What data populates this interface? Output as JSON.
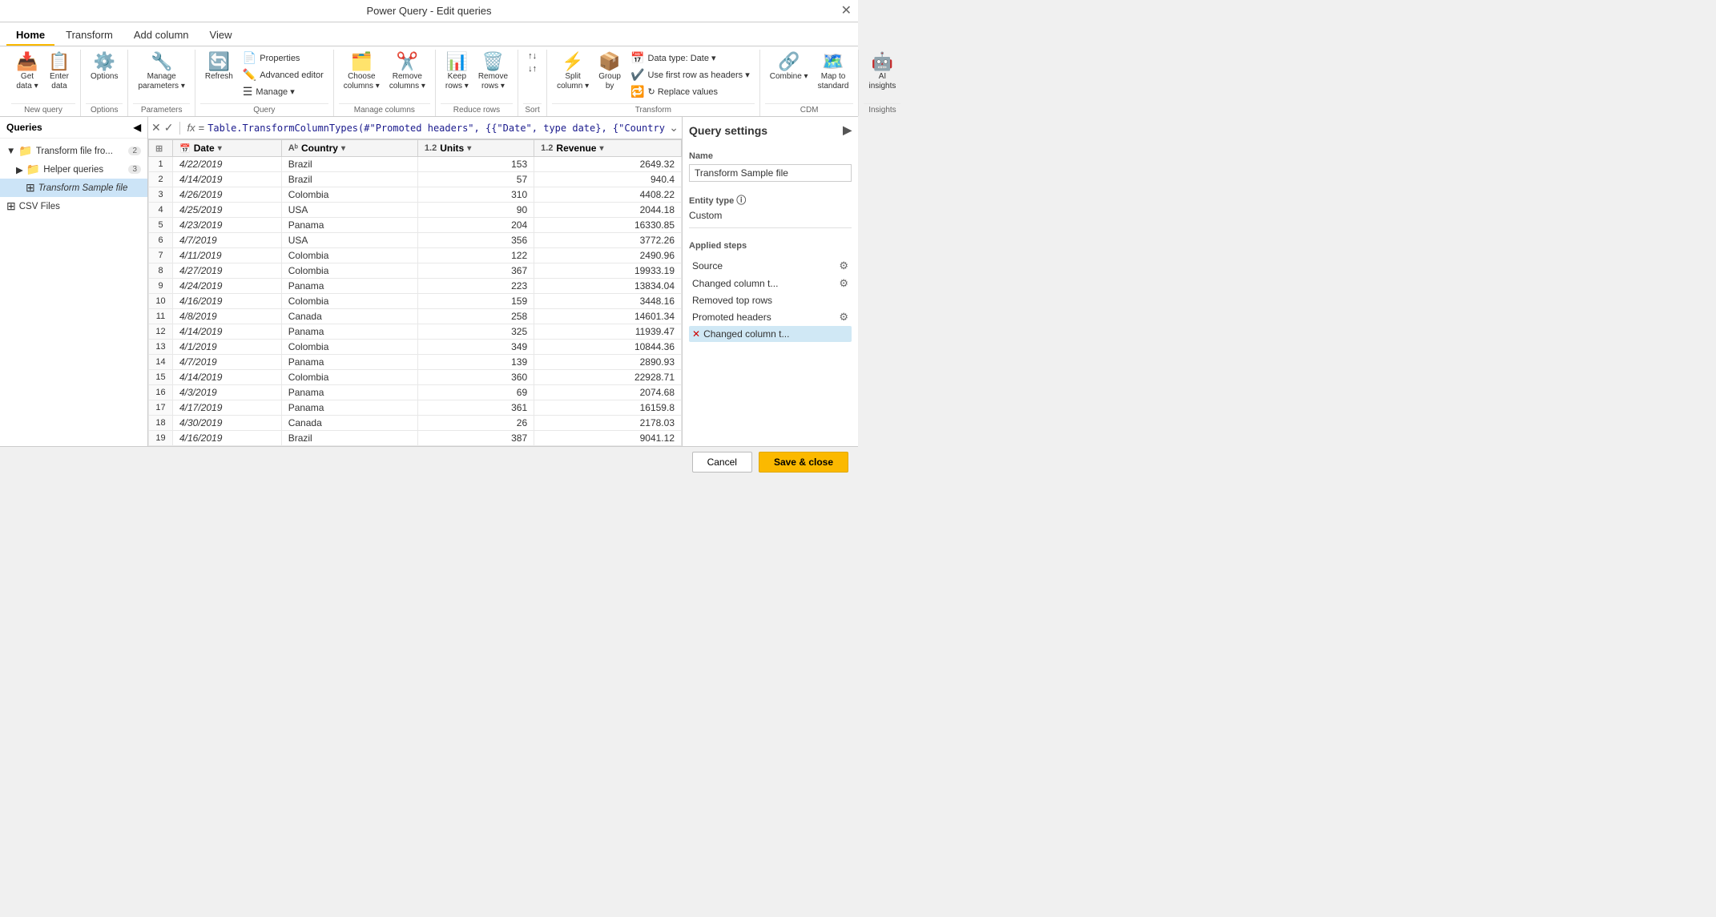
{
  "window": {
    "title": "Power Query - Edit queries",
    "close_btn": "✕"
  },
  "ribbon_tabs": [
    {
      "label": "Home",
      "active": true
    },
    {
      "label": "Transform",
      "active": false
    },
    {
      "label": "Add column",
      "active": false
    },
    {
      "label": "View",
      "active": false
    }
  ],
  "ribbon": {
    "new_query_group": {
      "label": "New query",
      "get_data": "Get data",
      "enter_data": "Enter data"
    },
    "options_group": {
      "label": "Options",
      "options": "Options"
    },
    "parameters_group": {
      "label": "Parameters",
      "manage_parameters": "Manage parameters"
    },
    "query_group": {
      "label": "Query",
      "properties": "Properties",
      "advanced_editor": "Advanced editor",
      "manage": "Manage",
      "refresh": "Refresh"
    },
    "manage_columns_group": {
      "label": "Manage columns",
      "choose_columns": "Choose columns",
      "remove_columns": "Remove columns"
    },
    "reduce_rows_group": {
      "label": "Reduce rows",
      "keep_rows": "Keep rows",
      "remove_rows": "Remove rows"
    },
    "sort_group": {
      "label": "Sort",
      "sort_asc": "↑",
      "sort_desc": "↓"
    },
    "transform_group": {
      "label": "Transform",
      "split_column": "Split column",
      "group_by": "Group by",
      "data_type": "Data type: Date",
      "use_first_row": "Use first row as headers",
      "replace_values": "Replace values"
    },
    "cdm_group": {
      "label": "CDM",
      "combine": "Combine",
      "map_to_standard": "Map to standard"
    },
    "insights_group": {
      "label": "Insights",
      "ai_insights": "AI insights"
    }
  },
  "formula_bar": {
    "formula": "Table.TransformColumnTypes(#\"Promoted headers\", {{\"Date\", type date}, {\"Country\", type text},"
  },
  "queries": {
    "header": "Queries",
    "items": [
      {
        "label": "Transform file fro...",
        "indent": 0,
        "icon": "📁",
        "badge": "2",
        "expanded": true
      },
      {
        "label": "Helper queries",
        "indent": 1,
        "icon": "📁",
        "badge": "3",
        "expanded": true
      },
      {
        "label": "Transform Sample file",
        "indent": 2,
        "icon": "⊞",
        "selected": true
      },
      {
        "label": "CSV Files",
        "indent": 0,
        "icon": "⊞",
        "selected": false
      }
    ]
  },
  "grid": {
    "columns": [
      {
        "label": "Date",
        "type": "📅"
      },
      {
        "label": "Country",
        "type": "Aᵇ"
      },
      {
        "label": "Units",
        "type": "1.2"
      },
      {
        "label": "Revenue",
        "type": "1.2"
      }
    ],
    "rows": [
      {
        "num": 1,
        "date": "4/22/2019",
        "country": "Brazil",
        "units": 153,
        "revenue": 2649.32
      },
      {
        "num": 2,
        "date": "4/14/2019",
        "country": "Brazil",
        "units": 57,
        "revenue": 940.4
      },
      {
        "num": 3,
        "date": "4/26/2019",
        "country": "Colombia",
        "units": 310,
        "revenue": 4408.22
      },
      {
        "num": 4,
        "date": "4/25/2019",
        "country": "USA",
        "units": 90,
        "revenue": 2044.18
      },
      {
        "num": 5,
        "date": "4/23/2019",
        "country": "Panama",
        "units": 204,
        "revenue": 16330.85
      },
      {
        "num": 6,
        "date": "4/7/2019",
        "country": "USA",
        "units": 356,
        "revenue": 3772.26
      },
      {
        "num": 7,
        "date": "4/11/2019",
        "country": "Colombia",
        "units": 122,
        "revenue": 2490.96
      },
      {
        "num": 8,
        "date": "4/27/2019",
        "country": "Colombia",
        "units": 367,
        "revenue": 19933.19
      },
      {
        "num": 9,
        "date": "4/24/2019",
        "country": "Panama",
        "units": 223,
        "revenue": 13834.04
      },
      {
        "num": 10,
        "date": "4/16/2019",
        "country": "Colombia",
        "units": 159,
        "revenue": 3448.16
      },
      {
        "num": 11,
        "date": "4/8/2019",
        "country": "Canada",
        "units": 258,
        "revenue": 14601.34
      },
      {
        "num": 12,
        "date": "4/14/2019",
        "country": "Panama",
        "units": 325,
        "revenue": 11939.47
      },
      {
        "num": 13,
        "date": "4/1/2019",
        "country": "Colombia",
        "units": 349,
        "revenue": 10844.36
      },
      {
        "num": 14,
        "date": "4/7/2019",
        "country": "Panama",
        "units": 139,
        "revenue": 2890.93
      },
      {
        "num": 15,
        "date": "4/14/2019",
        "country": "Colombia",
        "units": 360,
        "revenue": 22928.71
      },
      {
        "num": 16,
        "date": "4/3/2019",
        "country": "Panama",
        "units": 69,
        "revenue": 2074.68
      },
      {
        "num": 17,
        "date": "4/17/2019",
        "country": "Panama",
        "units": 361,
        "revenue": 16159.8
      },
      {
        "num": 18,
        "date": "4/30/2019",
        "country": "Canada",
        "units": 26,
        "revenue": 2178.03
      },
      {
        "num": 19,
        "date": "4/16/2019",
        "country": "Brazil",
        "units": 387,
        "revenue": 9041.12
      }
    ]
  },
  "settings": {
    "header": "Query settings",
    "name_label": "Name",
    "name_value": "Transform Sample file",
    "entity_type_label": "Entity type",
    "entity_type_value": "Custom",
    "applied_steps_label": "Applied steps",
    "steps": [
      {
        "label": "Source",
        "has_gear": true,
        "has_x": false,
        "selected": false
      },
      {
        "label": "Changed column t...",
        "has_gear": true,
        "has_x": false,
        "selected": false
      },
      {
        "label": "Removed top rows",
        "has_gear": false,
        "has_x": false,
        "selected": false
      },
      {
        "label": "Promoted headers",
        "has_gear": true,
        "has_x": false,
        "selected": false
      },
      {
        "label": "Changed column t...",
        "has_gear": false,
        "has_x": true,
        "selected": true
      }
    ]
  },
  "bottom_bar": {
    "cancel_label": "Cancel",
    "save_label": "Save & close"
  }
}
